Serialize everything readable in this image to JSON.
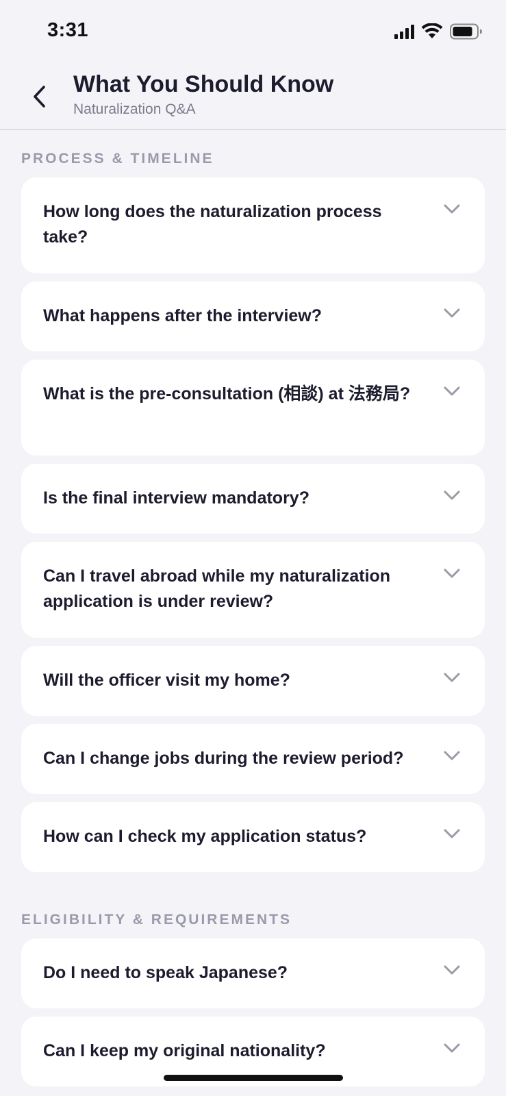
{
  "status_bar": {
    "time": "3:31"
  },
  "header": {
    "title": "What You Should Know",
    "subtitle": "Naturalization Q&A"
  },
  "sections": [
    {
      "title": "PROCESS & TIMELINE",
      "items": [
        "How long does the naturalization process take?",
        "What happens after the interview?",
        "What is the pre-consultation (相談) at 法務局?",
        "Is the final interview mandatory?",
        "Can I travel abroad while my naturalization application is under review?",
        "Will the officer visit my home?",
        "Can I change jobs during the review period?",
        "How can I check my application status?"
      ]
    },
    {
      "title": "ELIGIBILITY & REQUIREMENTS",
      "items": [
        "Do I need to speak Japanese?",
        "Can I keep my original nationality?"
      ]
    }
  ],
  "icons": {
    "back": "chevron-left-icon",
    "expand": "chevron-down-icon",
    "signal": "cellular-signal-icon",
    "wifi": "wifi-icon",
    "battery": "battery-icon"
  },
  "colors": {
    "background": "#f4f4f8",
    "card": "#ffffff",
    "text_primary": "#1c1c2e",
    "text_secondary": "#7a7a8c",
    "section_header": "#9a9aab",
    "chevron": "#9a9aa6"
  }
}
